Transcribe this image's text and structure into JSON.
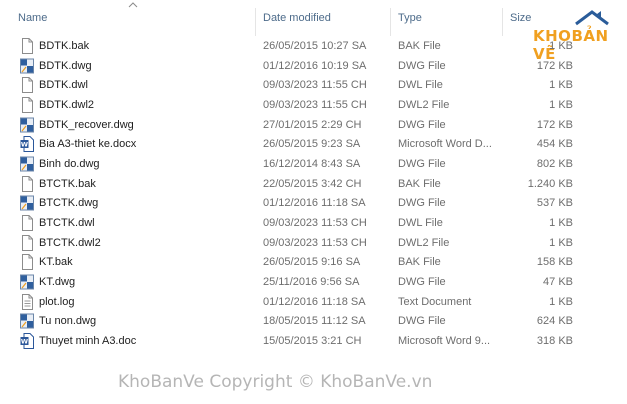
{
  "columns": {
    "name": "Name",
    "date_modified": "Date modified",
    "type": "Type",
    "size": "Size"
  },
  "logo": {
    "text_a": "KHO",
    "text_b": "BẢN VẼ",
    "accent_color": "#f0a020",
    "roof_color": "#2a5c9a"
  },
  "files": [
    {
      "name": "BDTK.bak",
      "date": "26/05/2015 10:27 SA",
      "type": "BAK File",
      "size": "1 KB",
      "icon": "blank-file-icon"
    },
    {
      "name": "BDTK.dwg",
      "date": "01/12/2016 10:19 SA",
      "type": "DWG File",
      "size": "172 KB",
      "icon": "dwg-file-icon"
    },
    {
      "name": "BDTK.dwl",
      "date": "09/03/2023 11:55 CH",
      "type": "DWL File",
      "size": "1 KB",
      "icon": "blank-file-icon"
    },
    {
      "name": "BDTK.dwl2",
      "date": "09/03/2023 11:55 CH",
      "type": "DWL2 File",
      "size": "1 KB",
      "icon": "blank-file-icon"
    },
    {
      "name": "BDTK_recover.dwg",
      "date": "27/01/2015 2:29 CH",
      "type": "DWG File",
      "size": "172 KB",
      "icon": "dwg-file-icon"
    },
    {
      "name": "Bia A3-thiet ke.docx",
      "date": "26/05/2015 9:23 SA",
      "type": "Microsoft Word D...",
      "size": "454 KB",
      "icon": "word-file-icon"
    },
    {
      "name": "Binh do.dwg",
      "date": "16/12/2014 8:43 SA",
      "type": "DWG File",
      "size": "802 KB",
      "icon": "dwg-file-icon"
    },
    {
      "name": "BTCTK.bak",
      "date": "22/05/2015 3:42 CH",
      "type": "BAK File",
      "size": "1.240 KB",
      "icon": "blank-file-icon"
    },
    {
      "name": "BTCTK.dwg",
      "date": "01/12/2016 11:18 SA",
      "type": "DWG File",
      "size": "537 KB",
      "icon": "dwg-file-icon"
    },
    {
      "name": "BTCTK.dwl",
      "date": "09/03/2023 11:53 CH",
      "type": "DWL File",
      "size": "1 KB",
      "icon": "blank-file-icon"
    },
    {
      "name": "BTCTK.dwl2",
      "date": "09/03/2023 11:53 CH",
      "type": "DWL2 File",
      "size": "1 KB",
      "icon": "blank-file-icon"
    },
    {
      "name": "KT.bak",
      "date": "26/05/2015 9:16 SA",
      "type": "BAK File",
      "size": "158 KB",
      "icon": "blank-file-icon"
    },
    {
      "name": "KT.dwg",
      "date": "25/11/2016 9:56 SA",
      "type": "DWG File",
      "size": "47 KB",
      "icon": "dwg-file-icon"
    },
    {
      "name": "plot.log",
      "date": "01/12/2016 11:18 SA",
      "type": "Text Document",
      "size": "1 KB",
      "icon": "text-file-icon"
    },
    {
      "name": "Tu non.dwg",
      "date": "18/05/2015 11:12 SA",
      "type": "DWG File",
      "size": "624 KB",
      "icon": "dwg-file-icon"
    },
    {
      "name": "Thuyet minh A3.doc",
      "date": "15/05/2015 3:21 CH",
      "type": "Microsoft Word 9...",
      "size": "318 KB",
      "icon": "word-file-icon"
    }
  ],
  "watermark": "KhoBanVe Copyright © KhoBanVe.vn"
}
